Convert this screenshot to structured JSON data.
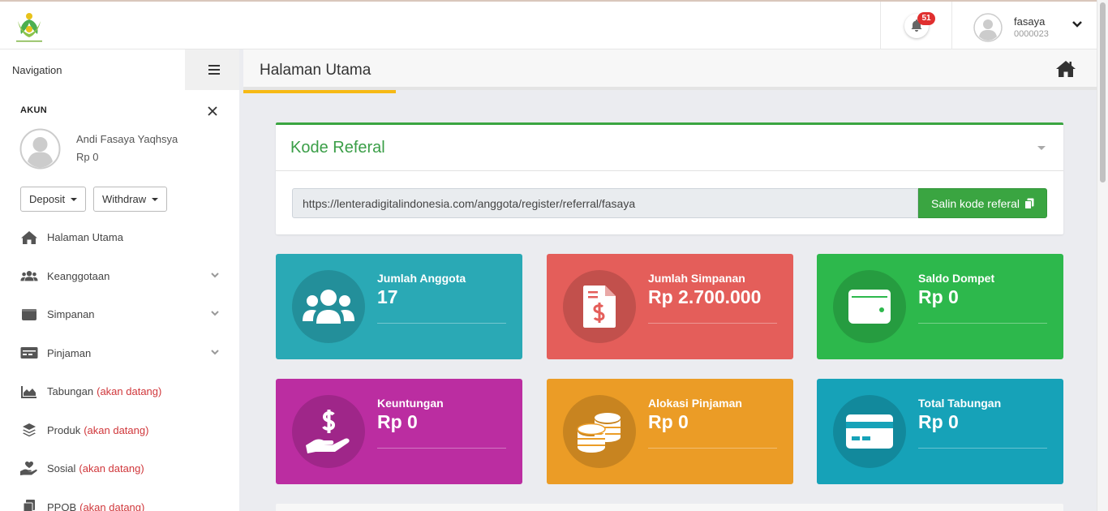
{
  "topbar": {
    "notifications_count": "51",
    "user": {
      "name": "fasaya",
      "id": "0000023"
    }
  },
  "sidebar": {
    "navigation_label": "Navigation",
    "account_label": "AKUN",
    "account_name": "Andi Fasaya Yaqhsya",
    "account_balance": "Rp 0",
    "deposit_label": "Deposit",
    "withdraw_label": "Withdraw",
    "items": [
      {
        "label": "Halaman Utama",
        "soon": "",
        "icon": "home-icon",
        "chevron": false
      },
      {
        "label": "Keanggotaan",
        "soon": "",
        "icon": "users-icon",
        "chevron": true
      },
      {
        "label": "Simpanan",
        "soon": "",
        "icon": "wallet-icon",
        "chevron": true
      },
      {
        "label": "Pinjaman",
        "soon": "",
        "icon": "money-check-icon",
        "chevron": true
      },
      {
        "label": "Tabungan",
        "soon": "(akan datang)",
        "icon": "chart-area-icon",
        "chevron": false
      },
      {
        "label": "Produk",
        "soon": "(akan datang)",
        "icon": "layers-icon",
        "chevron": false
      },
      {
        "label": "Sosial",
        "soon": "(akan datang)",
        "icon": "hand-heart-icon",
        "chevron": false
      },
      {
        "label": "PPOB",
        "soon": "(akan datang)",
        "icon": "copy-icon",
        "chevron": false
      }
    ]
  },
  "content": {
    "page_title": "Halaman Utama",
    "referral": {
      "title": "Kode Referal",
      "url": "https://lenteradigitalindonesia.com/anggota/register/referral/fasaya",
      "copy_label": "Salin kode referal"
    },
    "cards": [
      {
        "label": "Jumlah Anggota",
        "value": "17",
        "color": "#2aa9b5",
        "icon": "users-icon"
      },
      {
        "label": "Jumlah Simpanan",
        "value": "Rp 2.700.000",
        "color": "#e45e5a",
        "icon": "invoice-dollar-icon"
      },
      {
        "label": "Saldo Dompet",
        "value": "Rp 0",
        "color": "#2db84c",
        "icon": "wallet-icon"
      },
      {
        "label": "Keuntungan",
        "value": "Rp 0",
        "color": "#bb2da1",
        "icon": "hand-dollar-icon"
      },
      {
        "label": "Alokasi Pinjaman",
        "value": "Rp 0",
        "color": "#eb9c26",
        "icon": "coins-icon"
      },
      {
        "label": "Total Tabungan",
        "value": "Rp 0",
        "color": "#16a2b8",
        "icon": "credit-card-icon"
      }
    ]
  },
  "colors": {
    "accent_green": "#3aa541",
    "tab_underline": "#f6b915",
    "soon_red": "#d0373b",
    "badge_red": "#e02f2f"
  }
}
